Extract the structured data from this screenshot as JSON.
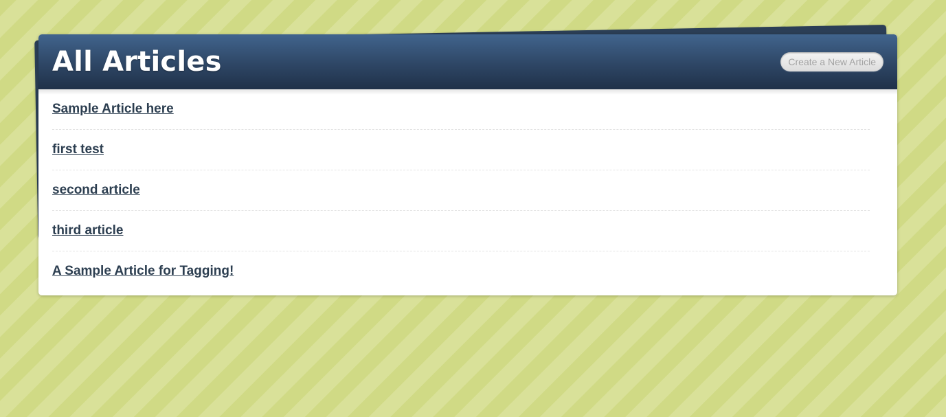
{
  "header": {
    "title": "All Articles",
    "create_button_label": "Create a New Article"
  },
  "articles": [
    {
      "title": "Sample Article here"
    },
    {
      "title": "first test"
    },
    {
      "title": "second article"
    },
    {
      "title": "third article"
    },
    {
      "title": "A Sample Article for Tagging!"
    }
  ],
  "colors": {
    "background": "#d6df96",
    "header_top": "#41648d",
    "header_bottom": "#1f3149",
    "link": "#2c3e50",
    "back_sheet": "#2b3e56"
  }
}
